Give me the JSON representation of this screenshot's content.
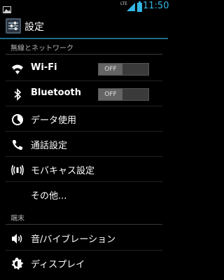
{
  "status": {
    "network_label": "LTE",
    "time": "11:50"
  },
  "header": {
    "title": "設定"
  },
  "sections": {
    "wireless": {
      "title": "無線とネットワーク"
    },
    "device": {
      "title": "端末"
    }
  },
  "items": {
    "wifi": {
      "label": "Wi-Fi",
      "toggle": "OFF",
      "icon": "wifi-icon"
    },
    "bluetooth": {
      "label": "Bluetooth",
      "toggle": "OFF",
      "icon": "bluetooth-icon"
    },
    "data": {
      "label": "データ使用",
      "icon": "data-usage-icon"
    },
    "call": {
      "label": "通話設定",
      "icon": "phone-icon"
    },
    "tether": {
      "label": "モバキャス設定",
      "icon": "broadcast-icon"
    },
    "more": {
      "label": "その他..."
    },
    "sound": {
      "label": "音/バイブレーション",
      "icon": "speaker-icon"
    },
    "display": {
      "label": "ディスプレイ",
      "icon": "brightness-icon"
    }
  },
  "colors": {
    "accent": "#33b5e5",
    "background": "#000000"
  }
}
